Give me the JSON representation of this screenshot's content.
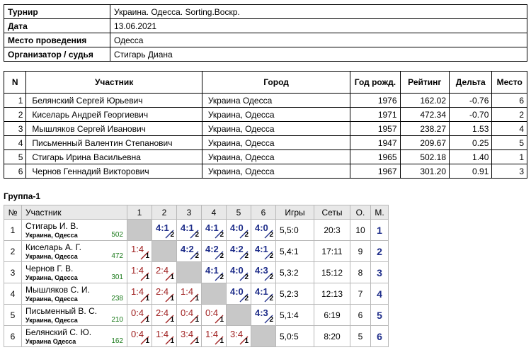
{
  "info": [
    {
      "label": "Турнир",
      "value": "Украина. Одесса. Sorting.Воскр."
    },
    {
      "label": "Дата",
      "value": "13.06.2021"
    },
    {
      "label": "Место проведения",
      "value": "Одесса"
    },
    {
      "label": "Организатор / судья",
      "value": "Стигарь Диана"
    }
  ],
  "participants": {
    "headers": [
      "N",
      "Участник",
      "Город",
      "Год рожд.",
      "Рейтинг",
      "Дельта",
      "Место"
    ],
    "rows": [
      [
        "1",
        "Белянский Сергей Юрьевич",
        "Украина Одесса",
        "1976",
        "162.02",
        "-0.76",
        "6"
      ],
      [
        "2",
        "Киселарь Андрей Георгиевич",
        "Украина, Одесса",
        "1971",
        "472.34",
        "-0.70",
        "2"
      ],
      [
        "3",
        "Мышляков Сергей Иванович",
        "Украина, Одесса",
        "1957",
        "238.27",
        "1.53",
        "4"
      ],
      [
        "4",
        "Письменный Валентин Степанович",
        "Украина, Одесса",
        "1947",
        "209.67",
        "0.25",
        "5"
      ],
      [
        "5",
        "Стигарь Ирина Васильевна",
        "Украина, Одесса",
        "1965",
        "502.18",
        "1.40",
        "1"
      ],
      [
        "6",
        "Чернов Геннадий Викторович",
        "Украина, Одесса",
        "1967",
        "301.20",
        "0.91",
        "3"
      ]
    ]
  },
  "group": {
    "title": "Группа-1",
    "headers": [
      "№",
      "Участник",
      "1",
      "2",
      "3",
      "4",
      "5",
      "6",
      "Игры",
      "Сеты",
      "О.",
      "М."
    ],
    "rows": [
      {
        "n": "1",
        "name": "Стигарь И. В.",
        "city": "Украина, Одесса",
        "rating": "502",
        "cells": [
          null,
          {
            "s": "4:1",
            "p": "2",
            "w": true
          },
          {
            "s": "4:1",
            "p": "2",
            "w": true
          },
          {
            "s": "4:1",
            "p": "2",
            "w": true
          },
          {
            "s": "4:0",
            "p": "2",
            "w": true
          },
          {
            "s": "4:0",
            "p": "2",
            "w": true
          }
        ],
        "games": "5,5:0",
        "sets": "20:3",
        "pts": "10",
        "place": "1"
      },
      {
        "n": "2",
        "name": "Киселарь А. Г.",
        "city": "Украина, Одесса",
        "rating": "472",
        "cells": [
          {
            "s": "1:4",
            "p": "1",
            "w": false
          },
          null,
          {
            "s": "4:2",
            "p": "2",
            "w": true
          },
          {
            "s": "4:2",
            "p": "2",
            "w": true
          },
          {
            "s": "4:2",
            "p": "2",
            "w": true
          },
          {
            "s": "4:1",
            "p": "2",
            "w": true
          }
        ],
        "games": "5,4:1",
        "sets": "17:11",
        "pts": "9",
        "place": "2"
      },
      {
        "n": "3",
        "name": "Чернов Г. В.",
        "city": "Украина, Одесса",
        "rating": "301",
        "cells": [
          {
            "s": "1:4",
            "p": "1",
            "w": false
          },
          {
            "s": "2:4",
            "p": "1",
            "w": false
          },
          null,
          {
            "s": "4:1",
            "p": "2",
            "w": true
          },
          {
            "s": "4:0",
            "p": "2",
            "w": true
          },
          {
            "s": "4:3",
            "p": "2",
            "w": true
          }
        ],
        "games": "5,3:2",
        "sets": "15:12",
        "pts": "8",
        "place": "3"
      },
      {
        "n": "4",
        "name": "Мышляков С. И.",
        "city": "Украина, Одесса",
        "rating": "238",
        "cells": [
          {
            "s": "1:4",
            "p": "1",
            "w": false
          },
          {
            "s": "2:4",
            "p": "1",
            "w": false
          },
          {
            "s": "1:4",
            "p": "1",
            "w": false
          },
          null,
          {
            "s": "4:0",
            "p": "2",
            "w": true
          },
          {
            "s": "4:1",
            "p": "2",
            "w": true
          }
        ],
        "games": "5,2:3",
        "sets": "12:13",
        "pts": "7",
        "place": "4"
      },
      {
        "n": "5",
        "name": "Письменный В. С.",
        "city": "Украина, Одесса",
        "rating": "210",
        "cells": [
          {
            "s": "0:4",
            "p": "1",
            "w": false
          },
          {
            "s": "2:4",
            "p": "1",
            "w": false
          },
          {
            "s": "0:4",
            "p": "1",
            "w": false
          },
          {
            "s": "0:4",
            "p": "1",
            "w": false
          },
          null,
          {
            "s": "4:3",
            "p": "2",
            "w": true
          }
        ],
        "games": "5,1:4",
        "sets": "6:19",
        "pts": "6",
        "place": "5"
      },
      {
        "n": "6",
        "name": "Белянский С. Ю.",
        "city": "Украина Одесса",
        "rating": "162",
        "cells": [
          {
            "s": "0:4",
            "p": "1",
            "w": false
          },
          {
            "s": "1:4",
            "p": "1",
            "w": false
          },
          {
            "s": "3:4",
            "p": "1",
            "w": false
          },
          {
            "s": "1:4",
            "p": "1",
            "w": false
          },
          {
            "s": "3:4",
            "p": "1",
            "w": false
          },
          null
        ],
        "games": "5,0:5",
        "sets": "8:20",
        "pts": "5",
        "place": "6"
      }
    ]
  },
  "colors": {
    "win": "#1e2d8a",
    "loss": "#a02020",
    "rating": "#1a7a1a",
    "self_cell": "#c8c8c8",
    "header_bg": "#e8e8e8"
  }
}
